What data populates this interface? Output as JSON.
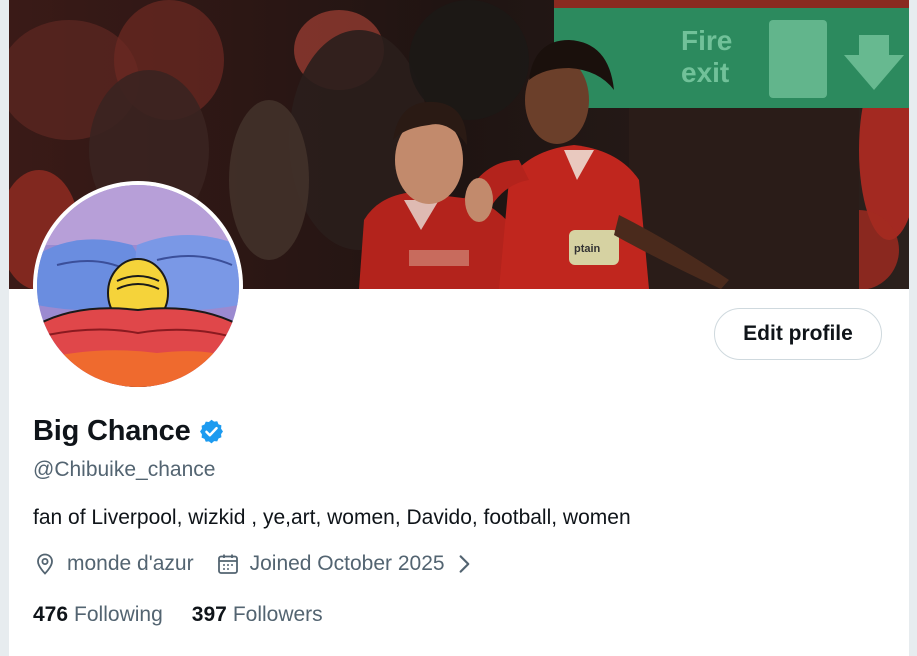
{
  "profile": {
    "display_name": "Big Chance",
    "handle": "@Chibuike_chance",
    "bio": "fan of Liverpool, wizkid , ye,art, women, Davido, football, women",
    "location": "monde d'azur",
    "joined": "Joined October 2025",
    "following_count": "476",
    "following_label": "Following",
    "followers_count": "397",
    "followers_label": "Followers",
    "verified": true
  },
  "actions": {
    "edit_profile_label": "Edit profile"
  },
  "banner": {
    "sign_text_line1": "Fire",
    "sign_text_line2": "exit",
    "armband_text": "ptain"
  },
  "icons": {
    "verified": "verified-badge-icon",
    "location": "location-pin-icon",
    "calendar": "calendar-icon",
    "chevron": "chevron-right-icon"
  },
  "colors": {
    "verified_blue": "#1d9bf0",
    "secondary_text": "#536471",
    "primary_text": "#0f1419",
    "border": "#cfd9de"
  }
}
